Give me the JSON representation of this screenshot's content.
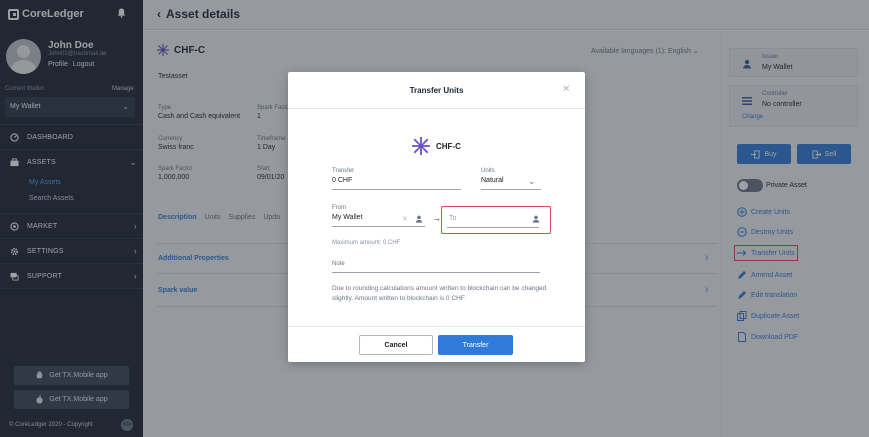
{
  "sidebar": {
    "logo": "CoreLedger",
    "user": {
      "name": "John Doe",
      "email": "John01@trashmail.de",
      "profile": "Profile",
      "logout": "Logout"
    },
    "wallet": {
      "label": "Current Wallet:",
      "manage": "Manage",
      "selected": "My Wallet"
    },
    "nav": {
      "dashboard": "DASHBOARD",
      "assets": "ASSETS",
      "my_assets": "My Assets",
      "search_assets": "Search Assets",
      "market": "MARKET",
      "settings": "SETTINGS",
      "support": "SUPPORT"
    },
    "apps": {
      "android": "Get TX.Mobile app",
      "ios": "Get TX.Mobile app"
    },
    "copyright": "© CoreLedger 2020 - Copyright"
  },
  "topbar": {
    "title": "Asset details"
  },
  "asset": {
    "code": "CHF-C",
    "name": "Testasset",
    "languages_label": "Available languages (1):",
    "language": "English",
    "fields": {
      "type_label": "Type",
      "type_value": "Cash and Cash equivalent",
      "spark_factor_label": "Spark Factor",
      "spark_factor_value": "1",
      "currency_label": "Currency",
      "currency_value": "Swiss franc",
      "timeframe_label": "Timeframe",
      "timeframe_value": "1 Day",
      "spark_factor2_label": "Spark Factor",
      "spark_factor2_value": "1,000,000",
      "start_label": "Start",
      "start_value": "09/01/20"
    },
    "tabs": [
      "Description",
      "Units",
      "Supplies",
      "Upda"
    ],
    "sections": {
      "additional": "Additional Properties",
      "spark": "Spark value"
    }
  },
  "right_panel": {
    "issuer_label": "Issuer",
    "issuer_value": "My Wallet",
    "controller_label": "Controller",
    "controller_value": "No controller",
    "change": "Change",
    "buy": "Buy",
    "sell": "Sell",
    "private_asset": "Private Asset",
    "actions": {
      "create": "Create Units",
      "destroy": "Destroy Units",
      "transfer": "Transfer Units",
      "amend": "Amend Asset",
      "edit_translation": "Edit translation",
      "duplicate": "Duplicate Asset",
      "download": "Download PDF"
    }
  },
  "modal": {
    "title": "Transfer Units",
    "asset_code": "CHF-C",
    "transfer_label": "Transfer",
    "transfer_value": "0 CHF",
    "units_label": "Units",
    "units_value": "Natural",
    "from_label": "From",
    "from_value": "My Wallet",
    "to_placeholder": "To",
    "max_amount": "Maximum amount: 0 CHF",
    "note_placeholder": "Note",
    "rounding_note": "Due to rounding calculations amount written to blockchain can be changed slightly. Amount written to blockchain is 0 CHF",
    "cancel": "Cancel",
    "transfer": "Transfer"
  },
  "colors": {
    "accent": "#2f7bd9",
    "sidebar": "#1c2535",
    "highlight": "#e0474c"
  }
}
